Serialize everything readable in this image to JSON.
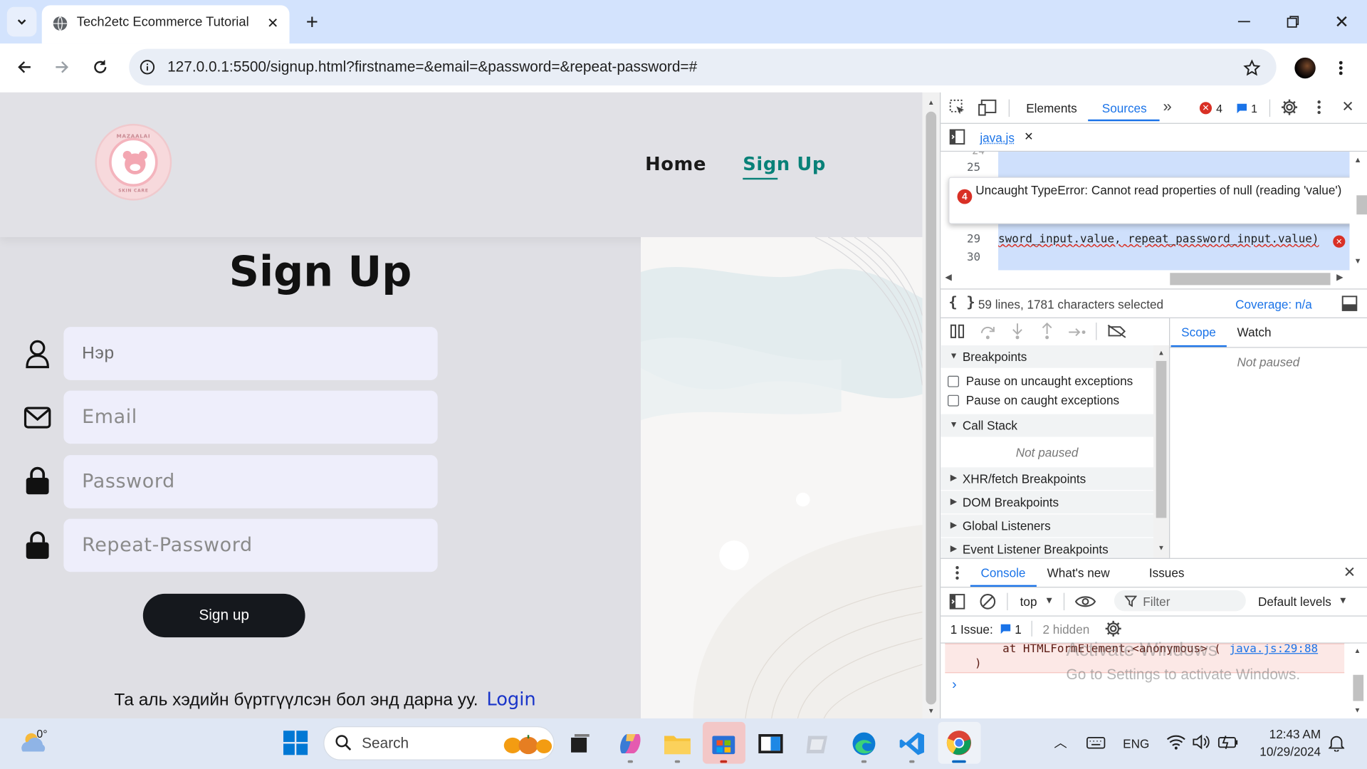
{
  "browser": {
    "tab_title": "Tech2etc Ecommerce Tutorial",
    "url": "127.0.0.1:5500/signup.html?firstname=&email=&password=&repeat-password=#"
  },
  "page": {
    "nav": {
      "home": "Home",
      "signup": "Sign Up"
    },
    "logo_top": "MAZAALAI",
    "logo_bottom": "SKIN CARE",
    "heading": "Sign Up",
    "fields": {
      "name": "Нэр",
      "email": "Email",
      "password": "Password",
      "repeat": "Repeat-Password"
    },
    "submit": "Sign up",
    "footer_text": "Та аль хэдийн бүртгүүлсэн бол энд дарна уу.",
    "login_link": "Login"
  },
  "devtools": {
    "tabs": {
      "elements": "Elements",
      "sources": "Sources"
    },
    "error_count": "4",
    "message_count": "1",
    "file_tab": "java.js",
    "line_numbers": [
      "25",
      "29",
      "30"
    ],
    "code_line_29": "sword_input.value, repeat_password_input.value)",
    "error_badge": "4",
    "error_popup": "Uncaught TypeError: Cannot read properties of null (reading 'value')",
    "status": "59 lines, 1781 characters selected",
    "coverage": "Coverage: n/a",
    "scope_tab": "Scope",
    "watch_tab": "Watch",
    "not_paused": "Not paused",
    "breakpoints": "Breakpoints",
    "pause_uncaught": "Pause on uncaught exceptions",
    "pause_caught": "Pause on caught exceptions",
    "call_stack": "Call Stack",
    "call_stack_state": "Not paused",
    "sections": [
      "XHR/fetch Breakpoints",
      "DOM Breakpoints",
      "Global Listeners",
      "Event Listener Breakpoints"
    ],
    "drawer_tabs": {
      "console": "Console",
      "whatsnew": "What's new",
      "issues": "Issues"
    },
    "context": "top",
    "filter_placeholder": "Filter",
    "levels": "Default levels",
    "issues_label": "1 Issue:",
    "issues_count": "1",
    "hidden": "2 hidden",
    "console_line1": "at HTMLFormElement.<anonymous> (",
    "console_link": "java.js:29:88",
    "console_line2": ")",
    "watermark1": "Activate Windows",
    "watermark2": "Go to Settings to activate Windows."
  },
  "taskbar": {
    "weather": "0°",
    "search": "Search",
    "lang": "ENG",
    "time": "12:43 AM",
    "date": "10/29/2024"
  },
  "colors": {
    "accent": "#1a73e8",
    "teal": "#088178",
    "error": "#d93025"
  }
}
